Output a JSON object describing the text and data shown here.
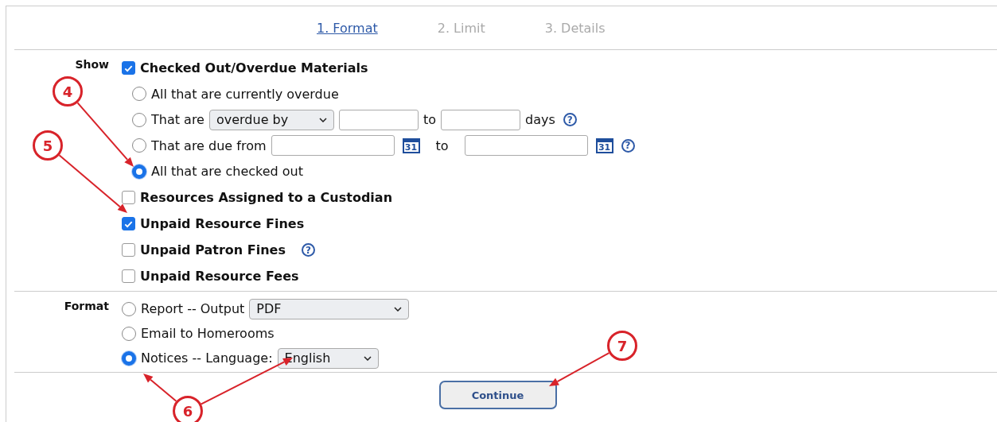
{
  "steps": [
    {
      "label": "1. Format",
      "selected": true
    },
    {
      "label": "2. Limit",
      "selected": false
    },
    {
      "label": "3. Details",
      "selected": false
    }
  ],
  "show": {
    "label": "Show",
    "items": [
      {
        "label": "Checked Out/Overdue Materials",
        "checked": true,
        "options": [
          {
            "kind": "plain",
            "label": "All that are currently overdue",
            "selected": false
          },
          {
            "kind": "select-range",
            "label": "That are",
            "selected": false,
            "select": "overdue by",
            "to": "to",
            "unit": "days",
            "help": "?"
          },
          {
            "kind": "date-range",
            "label": "That are due from",
            "selected": false,
            "calendar_from": "31",
            "to": "to",
            "calendar_to": "31",
            "help": "?"
          },
          {
            "kind": "plain",
            "label": "All that are checked out",
            "selected": true
          }
        ]
      },
      {
        "label": "Resources Assigned to a Custodian",
        "checked": false
      },
      {
        "label": "Unpaid Resource Fines",
        "checked": true
      },
      {
        "label": "Unpaid Patron Fines",
        "checked": false,
        "help": "?"
      },
      {
        "label": "Unpaid Resource Fees",
        "checked": false
      }
    ]
  },
  "format": {
    "label": "Format",
    "options": [
      {
        "label": "Report -- Output",
        "selected": false,
        "select": "PDF"
      },
      {
        "label": "Email to Homerooms",
        "selected": false
      },
      {
        "label": "Notices -- Language:",
        "selected": true,
        "select": "English"
      }
    ]
  },
  "continue_button": "Continue",
  "annotations": [
    {
      "number": "4"
    },
    {
      "number": "5"
    },
    {
      "number": "6"
    },
    {
      "number": "7"
    }
  ]
}
